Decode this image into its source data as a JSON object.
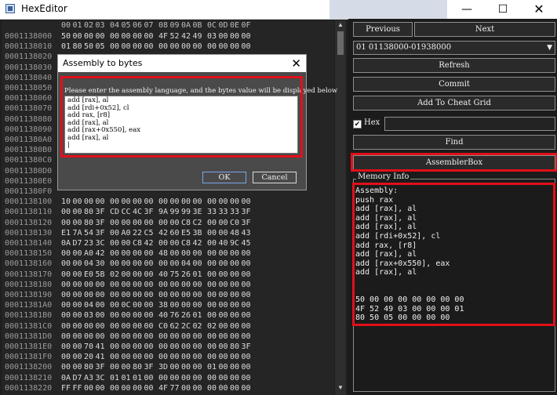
{
  "window": {
    "title": "HexEditor",
    "minimize": "—",
    "maximize": "☐",
    "close": "✕"
  },
  "hex": {
    "header_bytes": [
      "00",
      "01",
      "02",
      "03",
      "04",
      "05",
      "06",
      "07",
      "08",
      "09",
      "0A",
      "0B",
      "0C",
      "0D",
      "0E",
      "0F"
    ],
    "rows": [
      {
        "addr": "0001138000",
        "bytes": [
          "50",
          "00",
          "00",
          "00",
          "00",
          "00",
          "00",
          "00",
          "4F",
          "52",
          "42",
          "49",
          "03",
          "00",
          "00",
          "00"
        ]
      },
      {
        "addr": "0001138010",
        "bytes": [
          "01",
          "80",
          "50",
          "05",
          "00",
          "00",
          "00",
          "00",
          "00",
          "00",
          "00",
          "00",
          "00",
          "00",
          "00",
          "00"
        ]
      },
      {
        "addr": "0001138020",
        "bytes": [
          "",
          "",
          "",
          "",
          "",
          "",
          "",
          "",
          "",
          "",
          "",
          "",
          "",
          "",
          "",
          ""
        ]
      },
      {
        "addr": "0001138030",
        "bytes": [
          "",
          "",
          "",
          "",
          "",
          "",
          "",
          "",
          "",
          "",
          "",
          "",
          "",
          "",
          "",
          ""
        ]
      },
      {
        "addr": "0001138040",
        "bytes": [
          "",
          "",
          "",
          "",
          "",
          "",
          "",
          "",
          "",
          "",
          "",
          "",
          "",
          "",
          "",
          ""
        ]
      },
      {
        "addr": "0001138050",
        "bytes": [
          "",
          "",
          "",
          "",
          "",
          "",
          "",
          "",
          "",
          "",
          "",
          "",
          "",
          "",
          "",
          ""
        ]
      },
      {
        "addr": "0001138060",
        "bytes": [
          "",
          "",
          "",
          "",
          "",
          "",
          "",
          "",
          "",
          "",
          "",
          "",
          "",
          "",
          "",
          ""
        ]
      },
      {
        "addr": "0001138070",
        "bytes": [
          "",
          "",
          "",
          "",
          "",
          "",
          "",
          "",
          "",
          "",
          "",
          "",
          "",
          "",
          "",
          ""
        ]
      },
      {
        "addr": "0001138080",
        "bytes": [
          "",
          "",
          "",
          "",
          "",
          "",
          "",
          "",
          "",
          "",
          "",
          "",
          "",
          "",
          "",
          ""
        ]
      },
      {
        "addr": "0001138090",
        "bytes": [
          "",
          "",
          "",
          "",
          "",
          "",
          "",
          "",
          "",
          "",
          "",
          "",
          "",
          "",
          "",
          ""
        ]
      },
      {
        "addr": "00011380A0",
        "bytes": [
          "",
          "",
          "",
          "",
          "",
          "",
          "",
          "",
          "",
          "",
          "",
          "",
          "",
          "",
          "",
          ""
        ]
      },
      {
        "addr": "00011380B0",
        "bytes": [
          "",
          "",
          "",
          "",
          "",
          "",
          "",
          "",
          "",
          "",
          "",
          "",
          "",
          "",
          "",
          ""
        ]
      },
      {
        "addr": "00011380C0",
        "bytes": [
          "",
          "",
          "",
          "",
          "",
          "",
          "",
          "",
          "",
          "",
          "",
          "",
          "",
          "",
          "",
          ""
        ]
      },
      {
        "addr": "00011380D0",
        "bytes": [
          "",
          "",
          "",
          "",
          "",
          "",
          "",
          "",
          "",
          "",
          "",
          "",
          "",
          "",
          "",
          ""
        ]
      },
      {
        "addr": "00011380E0",
        "bytes": [
          "",
          "",
          "",
          "",
          "",
          "",
          "",
          "",
          "",
          "",
          "",
          "",
          "",
          "",
          "",
          ""
        ]
      },
      {
        "addr": "00011380F0",
        "bytes": [
          "",
          "",
          "",
          "",
          "",
          "",
          "",
          "",
          "",
          "",
          "",
          "",
          "",
          "",
          "",
          ""
        ]
      },
      {
        "addr": "0001138100",
        "bytes": [
          "10",
          "00",
          "00",
          "00",
          "00",
          "00",
          "00",
          "00",
          "00",
          "00",
          "00",
          "00",
          "00",
          "00",
          "00",
          "00"
        ]
      },
      {
        "addr": "0001138110",
        "bytes": [
          "00",
          "00",
          "80",
          "3F",
          "CD",
          "CC",
          "4C",
          "3F",
          "9A",
          "99",
          "99",
          "3E",
          "33",
          "33",
          "33",
          "3F"
        ]
      },
      {
        "addr": "0001138120",
        "bytes": [
          "00",
          "00",
          "80",
          "3F",
          "00",
          "00",
          "00",
          "00",
          "00",
          "00",
          "C8",
          "C2",
          "00",
          "00",
          "C0",
          "3F"
        ]
      },
      {
        "addr": "0001138130",
        "bytes": [
          "E1",
          "7A",
          "54",
          "3F",
          "00",
          "A0",
          "22",
          "C5",
          "42",
          "60",
          "E5",
          "3B",
          "00",
          "00",
          "48",
          "43"
        ]
      },
      {
        "addr": "0001138140",
        "bytes": [
          "0A",
          "D7",
          "23",
          "3C",
          "00",
          "00",
          "C8",
          "42",
          "00",
          "00",
          "C8",
          "42",
          "00",
          "40",
          "9C",
          "45"
        ]
      },
      {
        "addr": "0001138150",
        "bytes": [
          "00",
          "00",
          "A0",
          "42",
          "00",
          "00",
          "00",
          "00",
          "48",
          "00",
          "00",
          "00",
          "00",
          "00",
          "00",
          "00"
        ]
      },
      {
        "addr": "0001138160",
        "bytes": [
          "00",
          "00",
          "04",
          "30",
          "00",
          "00",
          "00",
          "00",
          "00",
          "00",
          "04",
          "00",
          "00",
          "00",
          "00",
          "00"
        ]
      },
      {
        "addr": "0001138170",
        "bytes": [
          "00",
          "00",
          "E0",
          "5B",
          "02",
          "00",
          "00",
          "00",
          "40",
          "75",
          "26",
          "01",
          "00",
          "00",
          "00",
          "00"
        ]
      },
      {
        "addr": "0001138180",
        "bytes": [
          "00",
          "00",
          "00",
          "00",
          "00",
          "00",
          "00",
          "00",
          "00",
          "00",
          "00",
          "00",
          "00",
          "00",
          "00",
          "00"
        ]
      },
      {
        "addr": "0001138190",
        "bytes": [
          "00",
          "00",
          "00",
          "00",
          "00",
          "00",
          "00",
          "00",
          "00",
          "00",
          "00",
          "00",
          "00",
          "00",
          "00",
          "00"
        ]
      },
      {
        "addr": "00011381A0",
        "bytes": [
          "00",
          "00",
          "04",
          "00",
          "00",
          "0C",
          "00",
          "00",
          "38",
          "00",
          "00",
          "00",
          "00",
          "00",
          "00",
          "00"
        ]
      },
      {
        "addr": "00011381B0",
        "bytes": [
          "00",
          "00",
          "03",
          "00",
          "00",
          "00",
          "00",
          "00",
          "40",
          "76",
          "26",
          "01",
          "00",
          "00",
          "00",
          "00"
        ]
      },
      {
        "addr": "00011381C0",
        "bytes": [
          "00",
          "00",
          "00",
          "00",
          "00",
          "00",
          "00",
          "00",
          "C0",
          "62",
          "2C",
          "02",
          "02",
          "00",
          "00",
          "00"
        ]
      },
      {
        "addr": "00011381D0",
        "bytes": [
          "00",
          "00",
          "00",
          "00",
          "00",
          "00",
          "00",
          "00",
          "00",
          "00",
          "00",
          "00",
          "00",
          "00",
          "00",
          "00"
        ]
      },
      {
        "addr": "00011381E0",
        "bytes": [
          "00",
          "00",
          "70",
          "41",
          "00",
          "00",
          "00",
          "00",
          "00",
          "00",
          "00",
          "00",
          "00",
          "00",
          "80",
          "3F"
        ]
      },
      {
        "addr": "00011381F0",
        "bytes": [
          "00",
          "00",
          "20",
          "41",
          "00",
          "00",
          "00",
          "00",
          "00",
          "00",
          "00",
          "00",
          "00",
          "00",
          "00",
          "00"
        ]
      },
      {
        "addr": "0001138200",
        "bytes": [
          "00",
          "00",
          "80",
          "3F",
          "00",
          "00",
          "80",
          "3F",
          "3D",
          "00",
          "00",
          "00",
          "01",
          "00",
          "00",
          "00"
        ]
      },
      {
        "addr": "0001138210",
        "bytes": [
          "0A",
          "D7",
          "A3",
          "3C",
          "01",
          "01",
          "01",
          "00",
          "00",
          "00",
          "00",
          "00",
          "00",
          "00",
          "00",
          "00"
        ]
      },
      {
        "addr": "0001138220",
        "bytes": [
          "FF",
          "FF",
          "00",
          "00",
          "00",
          "00",
          "00",
          "00",
          "4F",
          "77",
          "00",
          "00",
          "00",
          "00",
          "00",
          "00"
        ]
      }
    ]
  },
  "panel": {
    "previous_label": "Previous",
    "next_label": "Next",
    "range_select": "01 01138000-01938000",
    "refresh_label": "Refresh",
    "commit_label": "Commit",
    "add_to_cheat_grid_label": "Add To Cheat Grid",
    "hex_checkbox_label": "Hex",
    "hex_checked": true,
    "hex_input_value": "",
    "find_label": "Find",
    "assembler_box_label": "AssemblerBox",
    "memory_info_title": "Memory Info",
    "memory_info_text": "Assembly:\npush rax\nadd [rax], al\nadd [rax], al\nadd [rax], al\nadd [rdi+0x52], cl\nadd rax, [r8]\nadd [rax], al\nadd [rax+0x550], eax\nadd [rax], al\n\n\n50 00 00 00 00 00 00 00\n4F 52 49 03 00 00 00 01\n80 50 05 00 00 00 00"
  },
  "dialog": {
    "title": "Assembly to bytes",
    "close": "✕",
    "prompt": "Please enter the assembly language, and the bytes value will be displayed below",
    "textarea_value": "add [rax], al\nadd [rdi+0x52], cl\nadd rax, [r8]\nadd [rax], al\nadd [rax+0x550], eax\nadd [rax], al\n|",
    "ok_label": "OK",
    "cancel_label": "Cancel"
  },
  "colors": {
    "highlight": "#e0101a",
    "background": "#1e1e1e",
    "panel": "#1b1b1b"
  }
}
